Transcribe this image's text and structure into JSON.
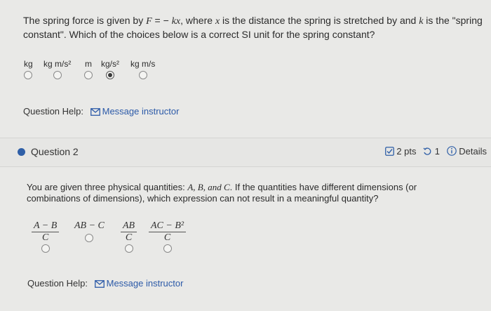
{
  "q1": {
    "text_1": "The spring force is given by ",
    "F": "F",
    "eq": " = − ",
    "kx": "kx",
    "text_2": ", where ",
    "x": "x",
    "text_3": " is the distance the spring is stretched by and ",
    "k": "k",
    "text_4": " is the \"spring constant\". Which of the choices below is a correct SI unit for the spring constant?",
    "options": [
      {
        "label": "kg",
        "selected": false
      },
      {
        "label": "kg m/s²",
        "selected": false
      },
      {
        "label": "m",
        "selected": false
      },
      {
        "label": "kg/s²",
        "selected": true
      },
      {
        "label": "kg m/s",
        "selected": false
      }
    ],
    "help_label": "Question Help:",
    "help_link": "Message instructor"
  },
  "q2": {
    "title": "Question 2",
    "points": "2 pts",
    "attempts": "1",
    "details": "Details",
    "text_1": "You are given three physical quantities: ",
    "vars": "A, B, and C",
    "text_2": ". If the quantities have different dimensions (or combinations of dimensions), which expression can not result in a meaningful quantity?",
    "options": [
      {
        "num": "A − B",
        "den": "C"
      },
      {
        "num": "AB − C",
        "den": ""
      },
      {
        "num": "AB",
        "den": "C"
      },
      {
        "num": "AC − B²",
        "den": "C"
      }
    ],
    "help_label": "Question Help:",
    "help_link": "Message instructor"
  },
  "colors": {
    "accent": "#2f5fa7",
    "link": "#2c5aa8",
    "background": "#e9e9e7"
  },
  "icons": [
    "mail-icon",
    "checkbox-icon",
    "retry-icon",
    "info-icon",
    "bullet-icon"
  ]
}
